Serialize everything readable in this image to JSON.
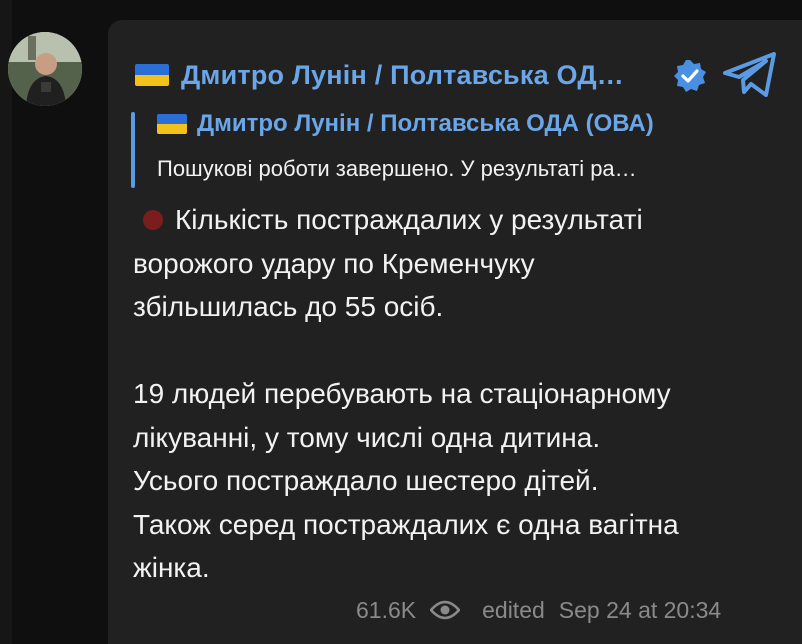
{
  "channel": {
    "name": "Дмитро Лунін / Полтавська ОД…"
  },
  "reply": {
    "title": "Дмитро Лунін / Полтавська ОДА (ОВА)",
    "preview": "Пошукові роботи завершено. У результаті ра…"
  },
  "message": {
    "lines_block1": [
      "Кількість постраждалих у результаті",
      "ворожого удару по Кременчуку",
      "збільшилась до 55 осіб."
    ],
    "lines_block2": [
      "19 людей перебувають на стаціонарному",
      "лікуванні, у тому числі одна дитина.",
      "Усього постраждало шестеро дітей.",
      "Також серед постраждалих є одна вагітна",
      "жінка."
    ]
  },
  "footer": {
    "views": "61.6K",
    "edited": "edited",
    "date": "Sep 24 at 20:34"
  },
  "colors": {
    "accent": "#6aa6e8",
    "reply_bar": "#5b9be3",
    "bubble": "#212121",
    "text": "#f2f2f2",
    "meta": "#8a8a8a",
    "red_dot": "#7a1d1d"
  },
  "icons": [
    "ukraine-flag-icon",
    "verified-badge-icon",
    "telegram-logo-icon",
    "eye-icon",
    "red-circle-icon"
  ]
}
